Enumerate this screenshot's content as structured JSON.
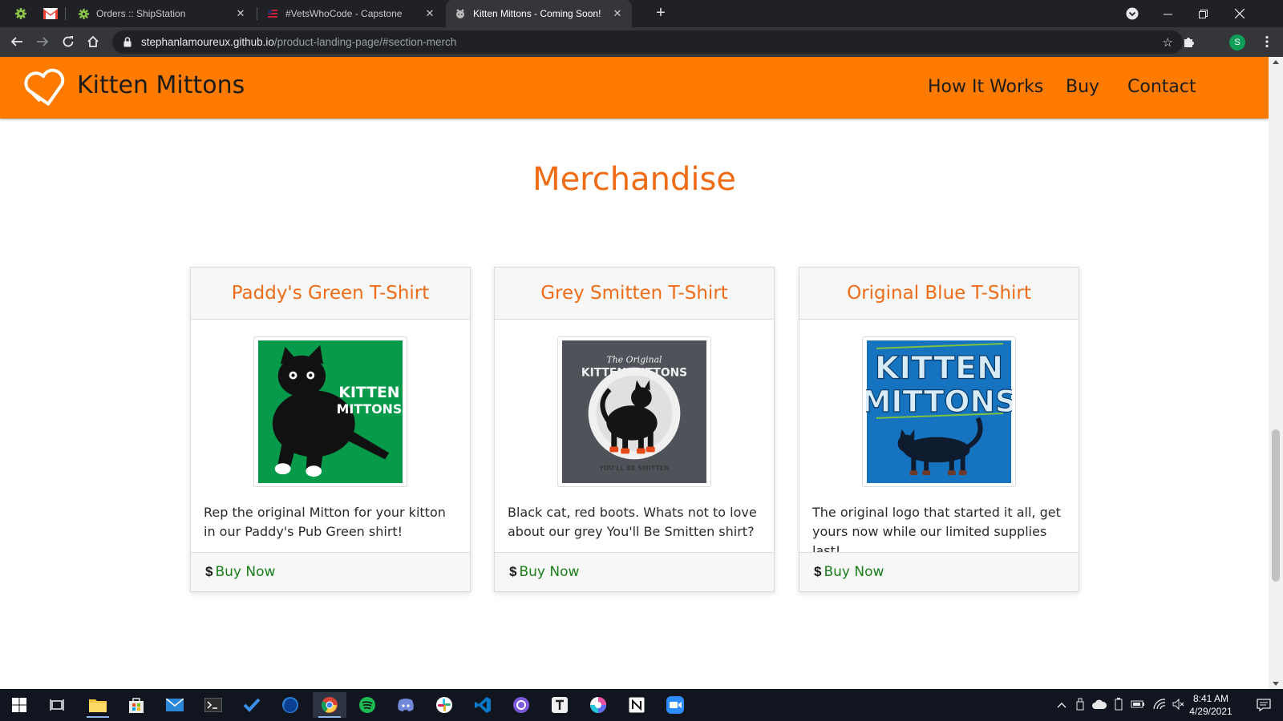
{
  "browser": {
    "tabs": [
      {
        "title": "Orders :: ShipStation",
        "active": false
      },
      {
        "title": "#VetsWhoCode - Capstone",
        "active": false
      },
      {
        "title": "Kitten Mittons - Coming Soon!",
        "active": true
      }
    ],
    "address": {
      "host": "stephanlamoureux.github.io",
      "path": "/product-landing-page/#section-merch"
    },
    "profile_initial": "S"
  },
  "site": {
    "brand": "Kitten Mittons",
    "nav": [
      "How It Works",
      "Buy",
      "Contact"
    ],
    "accent_color": "#ff7b00"
  },
  "merch": {
    "section_title": "Merchandise",
    "products": [
      {
        "name": "Paddy's Green T-Shirt",
        "image_text": [
          "KITTEN",
          "MITTONS"
        ],
        "description": "Rep the original Mitton for your kitton in our Paddy's Pub Green shirt!",
        "currency": "$",
        "cta": "Buy Now"
      },
      {
        "name": "Grey Smitten T-Shirt",
        "image_text": [
          "The Original",
          "KITTEN MITTONS",
          "YOU'LL BE SMITTEN"
        ],
        "description": "Black cat, red boots. Whats not to love about our grey You'll Be Smitten shirt?",
        "currency": "$",
        "cta": "Buy Now"
      },
      {
        "name": "Original Blue T-Shirt",
        "image_text": [
          "KITTEN",
          "MITTONS"
        ],
        "description": "The original logo that started it all, get yours now while our limited supplies last!",
        "currency": "$",
        "cta": "Buy Now"
      }
    ]
  },
  "taskbar": {
    "time": "8:41 AM",
    "date": "4/29/2021"
  }
}
